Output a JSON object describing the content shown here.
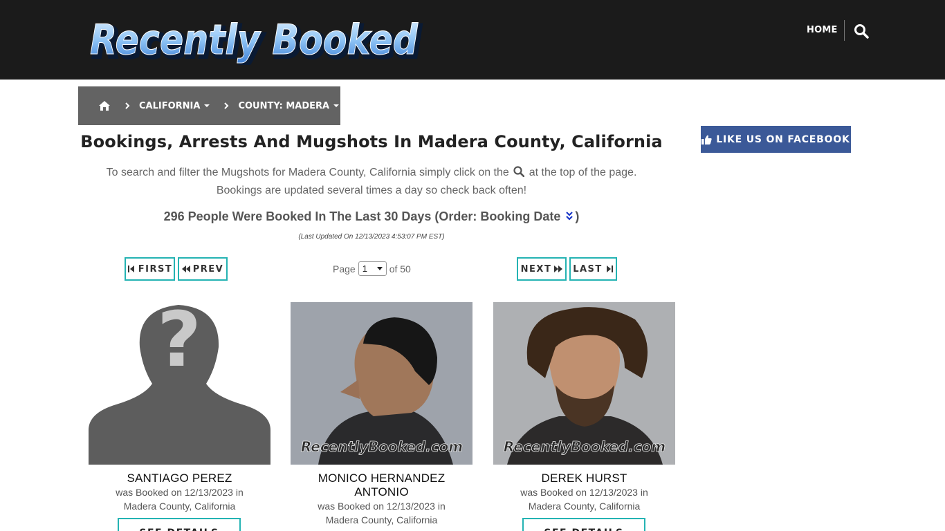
{
  "header": {
    "logo_text": "Recently Booked",
    "nav_home": "HOME",
    "search_icon": "search-icon"
  },
  "breadcrumb": {
    "home_icon": "home-icon",
    "items": [
      {
        "label": "CALIFORNIA"
      },
      {
        "label": "COUNTY: MADERA"
      }
    ]
  },
  "facebook": {
    "label": "LIKE US ON FACEBOOK",
    "icon": "thumbs-up-icon",
    "color": "#3b5998"
  },
  "main": {
    "title": "Bookings, Arrests And Mugshots In Madera County, California",
    "intro_part1": "To search and filter the Mugshots for Madera County, California simply click on the",
    "intro_part2": "at the top of the page.",
    "intro_line2": "Bookings are updated several times a day so check back often!",
    "count_text": "296 People Were Booked In The Last 30 Days (Order: Booking Date",
    "count_close": ")",
    "updated": "(Last Updated On 12/13/2023 4:53:07 PM EST)"
  },
  "pager": {
    "first": "FIRST",
    "prev": "PREV",
    "next": "NEXT",
    "last": "LAST",
    "page_label": "Page",
    "current_page": "1",
    "of_label": "of 50",
    "accent": "#24b3b3"
  },
  "bookings": [
    {
      "name": "SANTIAGO PEREZ",
      "booked": "was Booked on 12/13/2023 in",
      "location": "Madera County, California",
      "button": "SEE DETAILS"
    },
    {
      "name_line1": "MONICO HERNANDEZ",
      "name_line2": "ANTONIO",
      "booked": "was Booked on 12/13/2023 in",
      "location": "Madera County, California"
    },
    {
      "name": "DEREK HURST",
      "booked": "was Booked on 12/13/2023 in",
      "location": "Madera County, California",
      "button": "SEE DETAILS"
    }
  ],
  "watermark": "RecentlyBooked.com"
}
